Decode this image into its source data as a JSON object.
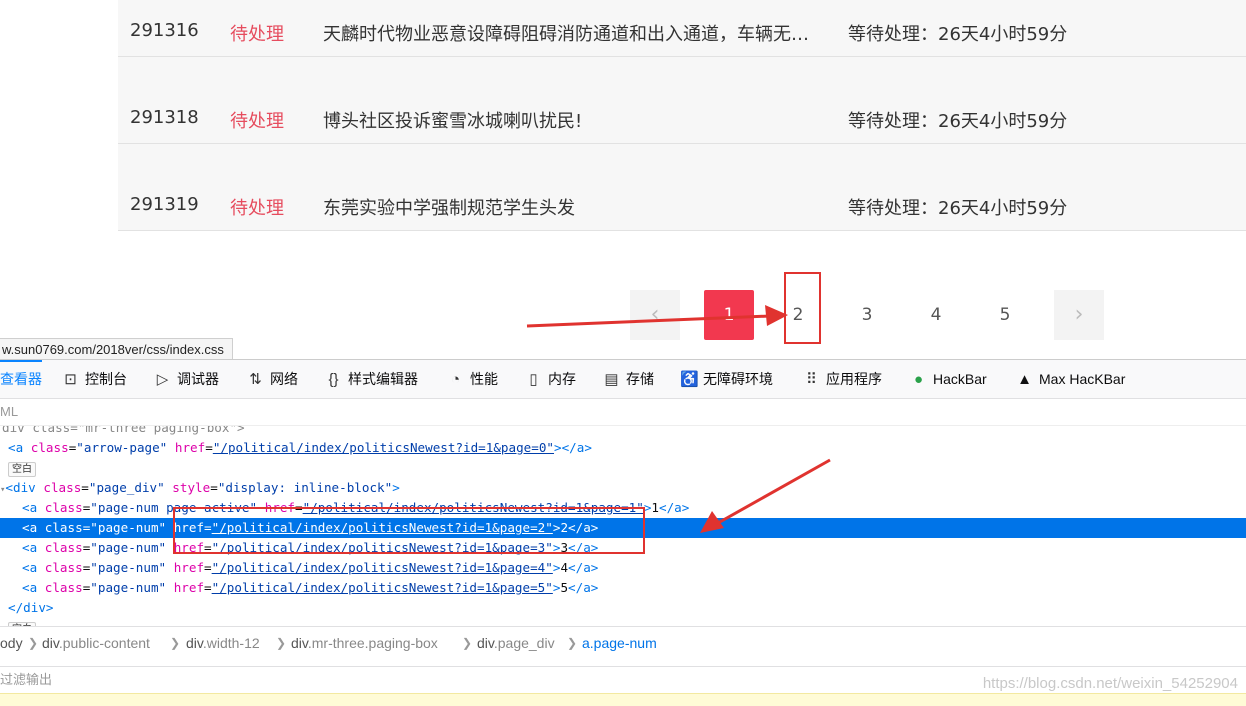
{
  "rows": [
    {
      "id": "291316",
      "status": "待处理",
      "title": "天麟时代物业恶意设障碍阻碍消防通道和出入通道，车辆无法…",
      "wait": "等待处理：26天4小时59分"
    },
    {
      "id": "291318",
      "status": "待处理",
      "title": "博头社区投诉蜜雪冰城喇叭扰民!",
      "wait": "等待处理：26天4小时59分"
    },
    {
      "id": "291319",
      "status": "待处理",
      "title": "东莞实验中学强制规范学生头发",
      "wait": "等待处理：26天4小时59分"
    }
  ],
  "pagination": {
    "prev": "‹",
    "next": "›",
    "pages": [
      "1",
      "2",
      "3",
      "4",
      "5"
    ],
    "active": "1"
  },
  "status_url": "w.sun0769.com/2018ver/css/index.css",
  "devtools": {
    "tabs": [
      {
        "icon": "inspector-icon",
        "glyph": "",
        "label": "查看器"
      },
      {
        "icon": "console-icon",
        "glyph": "⊡",
        "label": "控制台"
      },
      {
        "icon": "debugger-icon",
        "glyph": "▷",
        "label": "调试器"
      },
      {
        "icon": "network-icon",
        "glyph": "⇅",
        "label": "网络"
      },
      {
        "icon": "style-editor-icon",
        "glyph": "{}",
        "label": "样式编辑器"
      },
      {
        "icon": "performance-icon",
        "glyph": "◔",
        "label": "性能"
      },
      {
        "icon": "memory-icon",
        "glyph": "▯",
        "label": "内存"
      },
      {
        "icon": "storage-icon",
        "glyph": "▤",
        "label": "存储"
      },
      {
        "icon": "accessibility-icon",
        "glyph": "♿",
        "label": "无障碍环境"
      },
      {
        "icon": "application-icon",
        "glyph": "⠿",
        "label": "应用程序"
      },
      {
        "icon": "hackbar-icon",
        "glyph": "●",
        "label": "HackBar"
      },
      {
        "icon": "max-hackbar-icon",
        "glyph": "▲",
        "label": "Max HacKBar"
      }
    ],
    "search_placeholder": "ML",
    "code": {
      "line0": "div class=\"mr-three paging-box\">",
      "line1": {
        "tag_open": "<a",
        "cls": "\"arrow-page\"",
        "href": "\"/political/index/politicsNewest?id=1&page=0\"",
        "end": "></a>"
      },
      "line2_badge": "空白",
      "line3": {
        "tag_open": "<div",
        "cls": "\"page_div\"",
        "style": "\"display: inline-block\"",
        "end": ">"
      },
      "links": [
        {
          "cls": "\"page-num page-active\"",
          "href": "\"/political/index/politicsNewest?id=1&page=1\"",
          "text": "1"
        },
        {
          "cls": "\"page-num\"",
          "href": "\"/political/index/politicsNewest?id=1&page=2\"",
          "text": "2"
        },
        {
          "cls": "\"page-num\"",
          "href": "\"/political/index/politicsNewest?id=1&page=3\"",
          "text": "3"
        },
        {
          "cls": "\"page-num\"",
          "href": "\"/political/index/politicsNewest?id=1&page=4\"",
          "text": "4"
        },
        {
          "cls": "\"page-num\"",
          "href": "\"/political/index/politicsNewest?id=1&page=5\"",
          "text": "5"
        }
      ],
      "close_div": "</div>",
      "badge_bottom": "空白"
    },
    "breadcrumbs": [
      {
        "tag": "ody",
        "cls": ""
      },
      {
        "tag": "div",
        "cls": ".public-content"
      },
      {
        "tag": "div",
        "cls": ".width-12"
      },
      {
        "tag": "div",
        "cls": ".mr-three.paging-box"
      },
      {
        "tag": "div",
        "cls": ".page_div"
      },
      {
        "tag": "a",
        "cls": ".page-num"
      }
    ],
    "console_filter": "过滤输出"
  },
  "watermark": "https://blog.csdn.net/weixin_54252904",
  "colors": {
    "accent": "#0074e8",
    "active_page": "#f2384f",
    "status": "#e64c5e",
    "annotation": "#e0332f"
  }
}
